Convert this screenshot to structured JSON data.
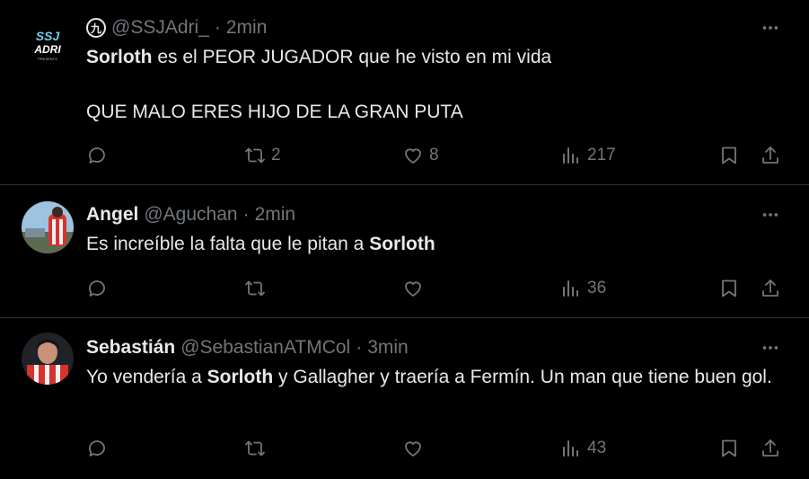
{
  "tweets": [
    {
      "display_name": "",
      "badge": "九",
      "handle": "@SSJAdri_",
      "separator": "·",
      "time": "2min",
      "avatar_text": [
        "SSJ",
        "ADRI",
        "PRESENTS"
      ],
      "line1_bold": "Sorloth",
      "line1_rest": " es el PEOR JUGADOR que he visto en mi vida",
      "line2": "QUE MALO ERES HIJO DE LA GRAN PUTA",
      "retweets": "2",
      "likes": "8",
      "views": "217"
    },
    {
      "display_name": "Angel",
      "handle": "@Aguchan",
      "separator": "·",
      "time": "2min",
      "text_pre": "Es increíble la falta que le pitan a ",
      "text_bold": "Sorloth",
      "views": "36"
    },
    {
      "display_name": "Sebastián",
      "handle": "@SebastianATMCol",
      "separator": "·",
      "time": "3min",
      "text_pre": "Yo vendería a ",
      "text_bold": "Sorloth",
      "text_post": " y Gallagher y traería a Fermín. Un man que tiene buen gol.",
      "views": "43"
    }
  ],
  "icons": {
    "reply": "reply-icon",
    "retweet": "retweet-icon",
    "like": "heart-icon",
    "views": "views-icon",
    "bookmark": "bookmark-icon",
    "share": "share-icon",
    "more": "more-icon"
  },
  "colors": {
    "background": "#000000",
    "text": "#e7e9ea",
    "muted": "#71767b",
    "divider": "#2f3336"
  }
}
